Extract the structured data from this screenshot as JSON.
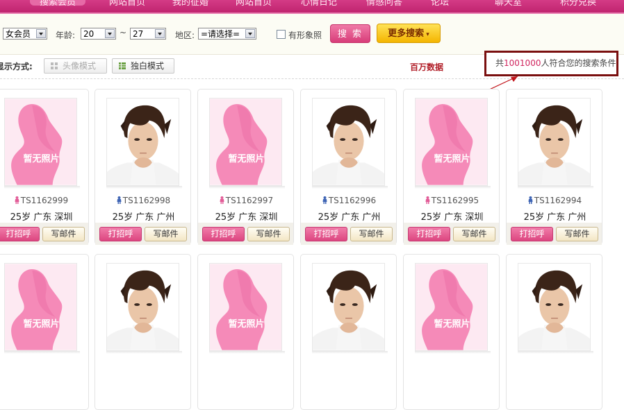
{
  "nav": {
    "items": [
      {
        "label": "搜索会员",
        "active": true
      },
      {
        "label": "网站首页"
      },
      {
        "label": "我的征婚"
      },
      {
        "label": "网站首页"
      },
      {
        "label": "心情日记"
      },
      {
        "label": "情感问答"
      },
      {
        "label": "论坛"
      },
      {
        "label": "聊天室"
      },
      {
        "label": "积分兑换"
      }
    ]
  },
  "search": {
    "member_type": "女会员",
    "age_label": "年龄:",
    "age_min": "20",
    "age_sep": "~",
    "age_max": "27",
    "region_label": "地区:",
    "region_value": "=请选择=",
    "photo_label": "有形象照",
    "search_label": "搜 索",
    "more_label": "更多搜索"
  },
  "display": {
    "label": "显示方式:",
    "mode_avatar": "头像模式",
    "mode_single": "独白模式",
    "million_note": "百万数据"
  },
  "result": {
    "prefix": "共",
    "count": "1001000",
    "suffix": "人符合您的搜索条件"
  },
  "cards": [
    {
      "id": "TS1162999",
      "gender": "female",
      "info": "25岁 广东 深圳",
      "photo": "placeholder"
    },
    {
      "id": "TS1162998",
      "gender": "male",
      "info": "25岁 广东 广州",
      "photo": "portrait"
    },
    {
      "id": "TS1162997",
      "gender": "female",
      "info": "25岁 广东 深圳",
      "photo": "placeholder"
    },
    {
      "id": "TS1162996",
      "gender": "male",
      "info": "25岁 广东 广州",
      "photo": "portrait"
    },
    {
      "id": "TS1162995",
      "gender": "female",
      "info": "25岁 广东 深圳",
      "photo": "placeholder"
    },
    {
      "id": "TS1162994",
      "gender": "male",
      "info": "25岁 广东 广州",
      "photo": "portrait"
    },
    {
      "photo": "placeholder"
    },
    {
      "photo": "portrait"
    },
    {
      "photo": "placeholder"
    },
    {
      "photo": "portrait"
    },
    {
      "photo": "placeholder"
    },
    {
      "photo": "portrait"
    }
  ],
  "card_labels": {
    "hi": "打招呼",
    "mail": "写邮件",
    "no_photo": "暂无照片"
  },
  "colors": {
    "brand_pink": "#d43b86",
    "female_icon": "#e25b97",
    "male_icon": "#3e64b4",
    "highlight_box": "#7a0f0f"
  }
}
